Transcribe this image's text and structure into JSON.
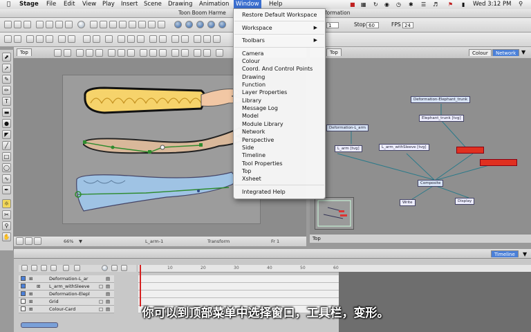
{
  "menubar": {
    "app": "Stage",
    "items": [
      "File",
      "Edit",
      "View",
      "Play",
      "Insert",
      "Scene",
      "Drawing",
      "Animation",
      "Window",
      "Help"
    ],
    "clock": "Wed 3:12 PM"
  },
  "window": {
    "title_left": "Toon Boom Harme",
    "title_right": "formation"
  },
  "playback": {
    "frame_value": "1",
    "stop_label": "Stop",
    "stop_value": "60",
    "fps_label": "FPS",
    "fps_value": "24"
  },
  "top_view": {
    "tab": "Top",
    "zoom": "66%",
    "status_layer": "L_arm-1",
    "status_tool": "Transform",
    "status_frame": "Fr 1"
  },
  "network_view": {
    "tab": "Top",
    "tabs": [
      "Colour",
      "Network"
    ],
    "nodes": [
      "Deformation-Elephant_trunk",
      "Elephant_trunk [tvg]",
      "Deformation-L_arm",
      "L_arm [tvg]",
      "L_arm_withSleeve [tvg]",
      "Composite",
      "Write",
      "Display"
    ],
    "footer": "Top"
  },
  "window_menu": {
    "items_top": [
      "Restore Default Workspace"
    ],
    "items_sub": [
      "Workspace",
      "Toolbars"
    ],
    "items_views": [
      "Camera",
      "Colour",
      "Coord. And Control Points",
      "Drawing",
      "Function",
      "Layer Properties",
      "Library",
      "Message Log",
      "Model",
      "Module Library",
      "Network",
      "Perspective",
      "Side",
      "Timeline",
      "Tool Properties",
      "Top",
      "Xsheet"
    ],
    "items_bottom": [
      "Integrated Help"
    ]
  },
  "timeline": {
    "tab": "Timeline",
    "ruler": [
      "10",
      "20",
      "30",
      "40",
      "50",
      "60"
    ],
    "layers": [
      {
        "name": "Deformation-L_ar",
        "checked": true
      },
      {
        "name": "L_arm_withSleeve",
        "checked": true
      },
      {
        "name": "Deformation-Elepl",
        "checked": true
      },
      {
        "name": "Grid",
        "checked": false
      },
      {
        "name": "Colour-Card",
        "checked": false
      }
    ]
  },
  "subtitle": "你可以到顶部菜单中选择窗口，工具栏，变形。"
}
